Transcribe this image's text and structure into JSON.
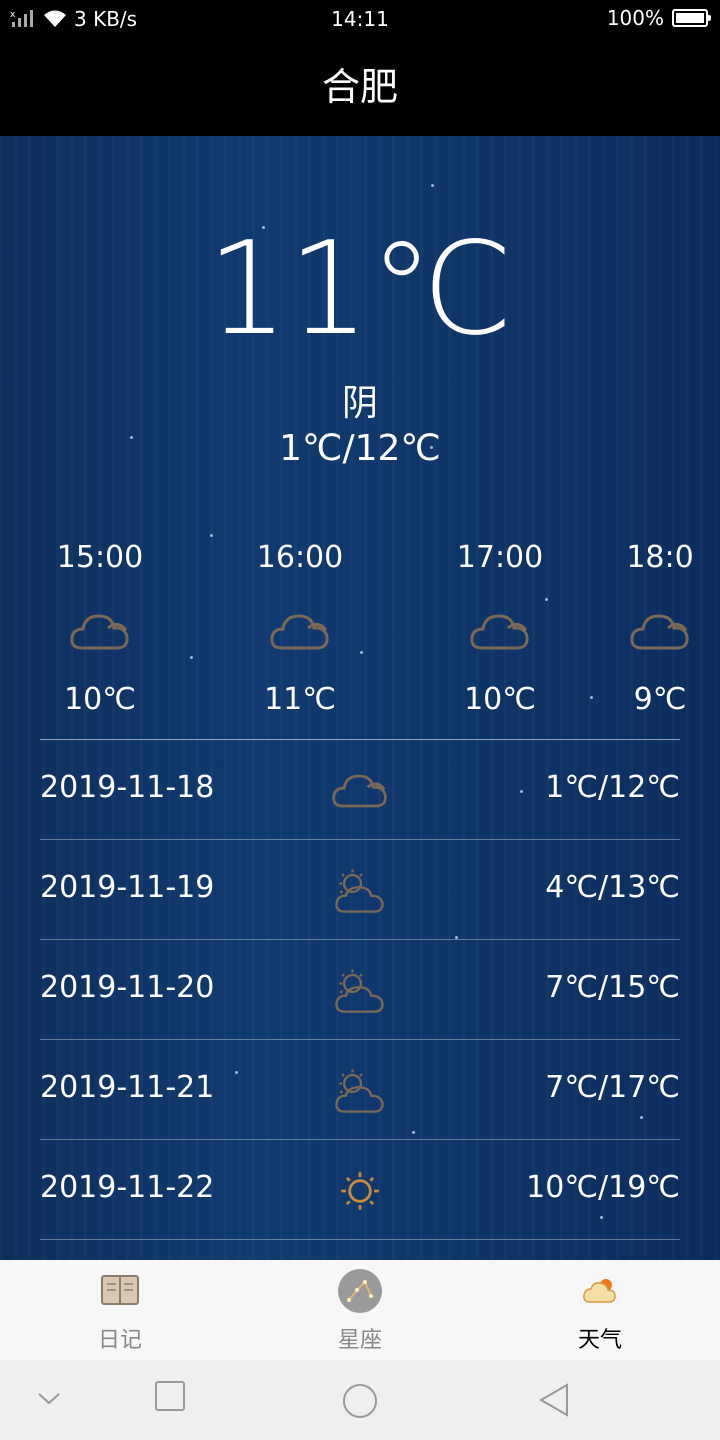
{
  "status": {
    "left_text": "3 KB/s",
    "time": "14:11",
    "battery": "100%"
  },
  "title": "合肥",
  "current": {
    "temp": "11℃",
    "condition": "阴",
    "range": "1℃/12℃"
  },
  "hourly": [
    {
      "time": "15:00",
      "temp": "10℃",
      "icon": "cloud-icon"
    },
    {
      "time": "16:00",
      "temp": "11℃",
      "icon": "cloud-icon"
    },
    {
      "time": "17:00",
      "temp": "10℃",
      "icon": "cloud-icon"
    },
    {
      "time": "18:0",
      "temp": "9℃",
      "icon": "cloud-icon"
    }
  ],
  "daily": [
    {
      "date": "2019-11-18",
      "range": "1℃/12℃",
      "icon": "cloud-icon"
    },
    {
      "date": "2019-11-19",
      "range": "4℃/13℃",
      "icon": "partly-cloudy-icon"
    },
    {
      "date": "2019-11-20",
      "range": "7℃/15℃",
      "icon": "partly-cloudy-icon"
    },
    {
      "date": "2019-11-21",
      "range": "7℃/17℃",
      "icon": "partly-cloudy-icon"
    },
    {
      "date": "2019-11-22",
      "range": "10℃/19℃",
      "icon": "sun-icon"
    }
  ],
  "tabs": [
    {
      "label": "日记",
      "icon": "diary-icon"
    },
    {
      "label": "星座",
      "icon": "constellation-icon"
    },
    {
      "label": "天气",
      "icon": "weather-icon",
      "active": true
    }
  ],
  "colors": {
    "icon_stroke": "#7a6a55",
    "sun": "#e8901c",
    "background": "#0e3567"
  }
}
